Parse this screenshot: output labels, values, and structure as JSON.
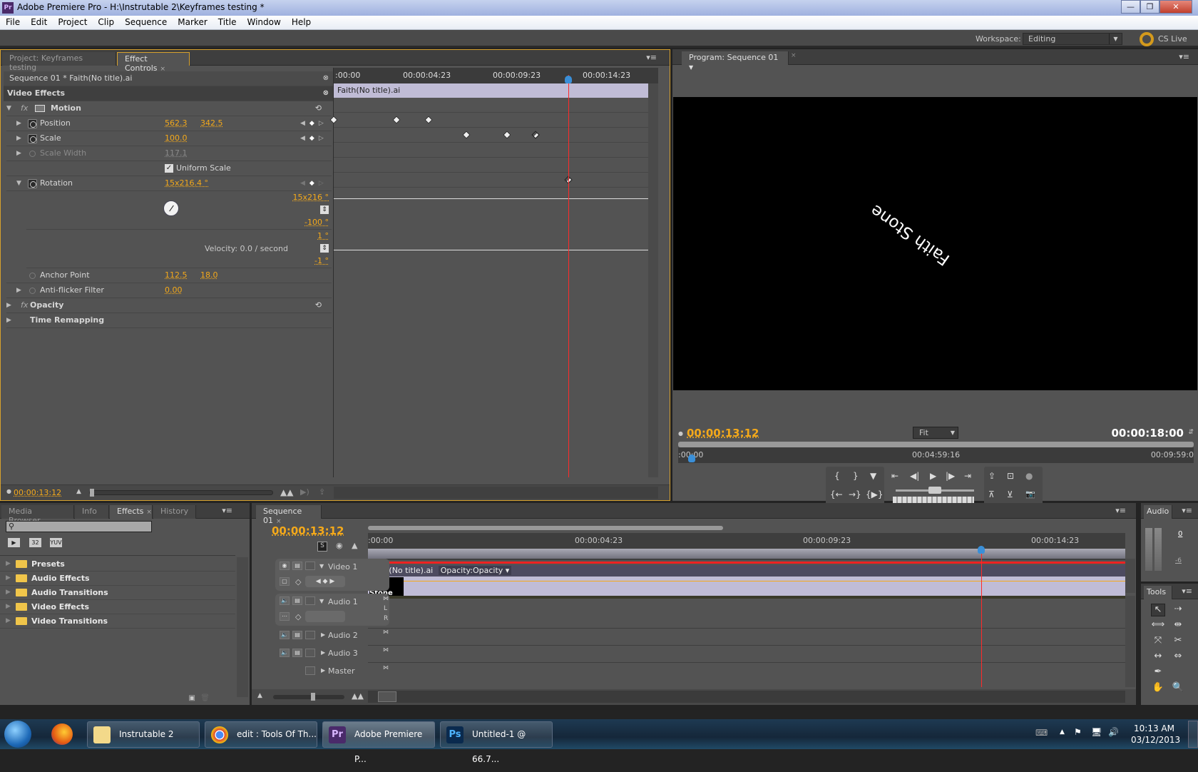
{
  "window": {
    "title": "Adobe Premiere Pro - H:\\Instrutable 2\\Keyframes testing *",
    "app_icon": "Pr",
    "controls": [
      "minimize",
      "restore",
      "close"
    ]
  },
  "menu": [
    "File",
    "Edit",
    "Project",
    "Clip",
    "Sequence",
    "Marker",
    "Title",
    "Window",
    "Help"
  ],
  "workspace": {
    "label": "Workspace:",
    "value": "Editing",
    "cs_live": "CS Live"
  },
  "effect_controls": {
    "tabs": [
      {
        "label": "Project: Keyframes testing",
        "active": false
      },
      {
        "label": "Effect Controls",
        "active": true,
        "closable": true
      }
    ],
    "clip_path": "Sequence 01 * Faith(No title).ai",
    "section": "Video Effects",
    "effects": {
      "motion": {
        "name": "Motion",
        "fx": "fx",
        "position": {
          "label": "Position",
          "x": "562.3",
          "y": "342.5"
        },
        "scale": {
          "label": "Scale",
          "value": "100.0"
        },
        "scale_width": {
          "label": "Scale Width",
          "value": "117.1"
        },
        "uniform_scale": {
          "label": "Uniform Scale",
          "checked": true
        },
        "rotation": {
          "label": "Rotation",
          "value": "15x216.4 °",
          "graph_max": "15x216 °",
          "graph_min": "-100 °",
          "vel_max": "1 °",
          "vel_min": "-1 °",
          "velocity": "Velocity: 0.0 / second"
        },
        "anchor_point": {
          "label": "Anchor Point",
          "x": "112.5",
          "y": "18.0"
        },
        "anti_flicker": {
          "label": "Anti-flicker Filter",
          "value": "0.00"
        }
      },
      "opacity": {
        "name": "Opacity",
        "fx": "fx"
      },
      "time_remapping": {
        "name": "Time Remapping"
      }
    },
    "timeline": {
      "ruler": [
        ":00:00",
        "00:00:04:23",
        "00:00:09:23",
        "00:00:14:23"
      ],
      "clip_name": "Faith(No title).ai",
      "keyframes": {
        "position": [
          0.0,
          0.2,
          0.3
        ],
        "scale": [
          0.42,
          0.55,
          0.64
        ],
        "rotation": [
          0.745
        ]
      },
      "playhead": 0.745
    },
    "footer_timecode": "00:00:13:12"
  },
  "program_monitor": {
    "tab": "Program: Sequence 01",
    "overlay_text": "Faith Stone",
    "current_timecode": "00:00:13:12",
    "zoom": "Fit",
    "duration": "00:00:18:00",
    "ruler": [
      ":00:00",
      "00:04:59:16",
      "00:09:59:0"
    ],
    "controls": {
      "marks": [
        "{",
        "}",
        "▼"
      ],
      "transport": [
        "⇤",
        "◀|",
        "▶",
        "|▶",
        "⇥"
      ],
      "marks2": [
        "{←",
        "→}",
        "{▶}"
      ],
      "out": [
        "⇪",
        "⊡",
        "●"
      ],
      "out2": [
        "⊼",
        "⊻",
        "📷"
      ]
    }
  },
  "effects_panel": {
    "tabs": [
      {
        "label": "Media Browser"
      },
      {
        "label": "Info"
      },
      {
        "label": "Effects",
        "active": true,
        "closable": true
      },
      {
        "label": "History"
      }
    ],
    "search_placeholder": "",
    "filter_buttons": [
      "▶",
      "32",
      "YUV"
    ],
    "items": [
      "Presets",
      "Audio Effects",
      "Audio Transitions",
      "Video Effects",
      "Video Transitions"
    ]
  },
  "sequence": {
    "tab": "Sequence 01",
    "timecode": "00:00:13:12",
    "ruler": [
      ":00:00",
      "00:00:04:23",
      "00:00:09:23",
      "00:00:14:23"
    ],
    "playhead": 0.81,
    "tracks": [
      {
        "name": "Video 1",
        "type": "video",
        "expanded": true
      },
      {
        "name": "Audio 1",
        "type": "audio",
        "expanded": true,
        "channels": [
          "L",
          "R"
        ]
      },
      {
        "name": "Audio 2",
        "type": "audio",
        "expanded": false
      },
      {
        "name": "Audio 3",
        "type": "audio",
        "expanded": false
      },
      {
        "name": "Master",
        "type": "master",
        "expanded": false
      }
    ],
    "clip": {
      "name": "Faith(No title).ai",
      "property": "Opacity:Opacity",
      "thumb_text": "aith Stone"
    }
  },
  "audio_meters": {
    "tab": "Audio",
    "labels": [
      "0",
      "-6"
    ]
  },
  "tools": {
    "tab": "Tools",
    "items": [
      "selection",
      "track-select",
      "ripple-edit",
      "rolling-edit",
      "rate-stretch",
      "razor",
      "slip",
      "slide",
      "pen",
      "hand",
      "zoom"
    ]
  },
  "taskbar": {
    "buttons": [
      {
        "label": "Instrutable 2",
        "icon": "folder"
      },
      {
        "label": "edit : Tools Of Th...",
        "icon": "chrome"
      },
      {
        "label": "Adobe Premiere P...",
        "icon": "Pr",
        "active": true
      },
      {
        "label": "Untitled-1 @ 66.7...",
        "icon": "Ps"
      }
    ],
    "time": "10:13 AM",
    "date": "03/12/2013"
  }
}
